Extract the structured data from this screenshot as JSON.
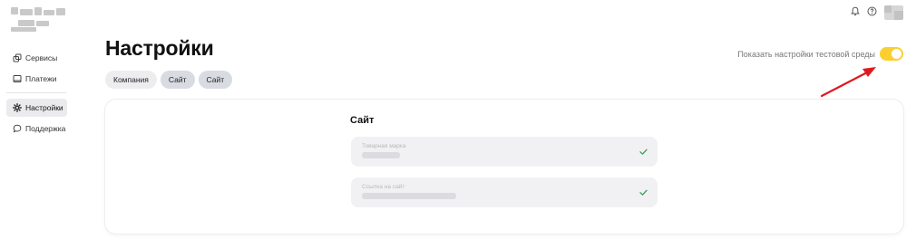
{
  "page": {
    "title": "Настройки"
  },
  "sidebar": {
    "items": [
      {
        "label": "Сервисы",
        "icon": "services-icon"
      },
      {
        "label": "Платежи",
        "icon": "payments-icon"
      },
      {
        "label": "Настройки",
        "icon": "gear-icon",
        "active": true
      },
      {
        "label": "Поддержка",
        "icon": "chat-bubble-icon"
      }
    ]
  },
  "tabs": [
    {
      "label": "Компания"
    },
    {
      "label": "Сайт"
    },
    {
      "label": "Сайт"
    }
  ],
  "test_env_toggle": {
    "label": "Показать настройки тестовой среды",
    "on": true
  },
  "site_card": {
    "title": "Сайт",
    "fields": [
      {
        "label": "Товарная марка"
      },
      {
        "label": "Ссылка на сайт"
      }
    ]
  },
  "colors": {
    "toggle_on": "#fbcf2f",
    "arrow": "#e0191f",
    "check": "#3a9a5b"
  }
}
